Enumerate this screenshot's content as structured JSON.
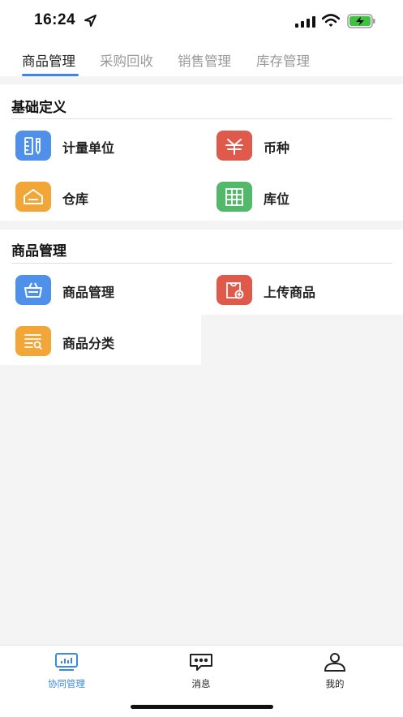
{
  "status_bar": {
    "time": "16:24"
  },
  "tabs": [
    {
      "label": "商品管理",
      "active": true
    },
    {
      "label": "采购回收",
      "active": false
    },
    {
      "label": "销售管理",
      "active": false
    },
    {
      "label": "库存管理",
      "active": false
    }
  ],
  "sections": [
    {
      "title": "基础定义",
      "items": [
        {
          "label": "计量单位",
          "icon": "ruler-pencil-icon",
          "color": "#4f91ea"
        },
        {
          "label": "币种",
          "icon": "yen-currency-icon",
          "color": "#df5a4a"
        },
        {
          "label": "仓库",
          "icon": "warehouse-icon",
          "color": "#f2a637"
        },
        {
          "label": "库位",
          "icon": "grid-shelf-icon",
          "color": "#53b86a"
        }
      ]
    },
    {
      "title": "商品管理",
      "items": [
        {
          "label": "商品管理",
          "icon": "basket-icon",
          "color": "#4f91ea"
        },
        {
          "label": "上传商品",
          "icon": "bag-upload-icon",
          "color": "#df5a4a"
        },
        {
          "label": "商品分类",
          "icon": "list-search-icon",
          "color": "#f2a637"
        }
      ]
    }
  ],
  "bottom_nav": [
    {
      "label": "协同管理",
      "icon": "dashboard-icon",
      "active": true
    },
    {
      "label": "消息",
      "icon": "message-icon",
      "active": false
    },
    {
      "label": "我的",
      "icon": "user-icon",
      "active": false
    }
  ],
  "colors": {
    "accent": "#3b87e6",
    "background": "#f4f4f4"
  }
}
